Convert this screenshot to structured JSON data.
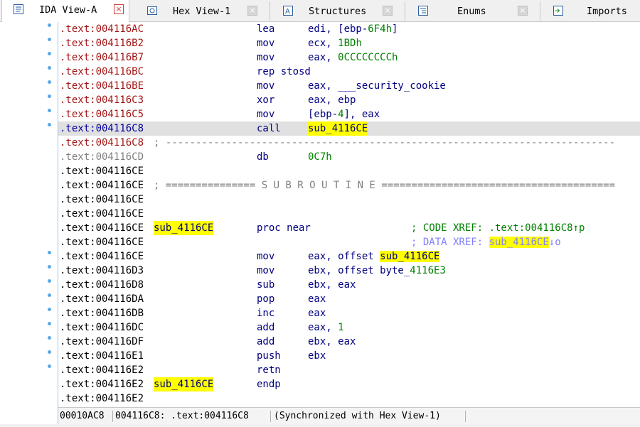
{
  "tabs": [
    {
      "label": "IDA View-A",
      "icon": "disassembly-view-icon",
      "active": true
    },
    {
      "label": "Hex View-1",
      "icon": "hex-view-icon",
      "active": false
    },
    {
      "label": "Structures",
      "icon": "structures-icon",
      "active": false
    },
    {
      "label": "Enums",
      "icon": "enums-icon",
      "active": false
    },
    {
      "label": "Imports",
      "icon": "imports-icon",
      "active": false
    }
  ],
  "close_glyph": "×",
  "listing": {
    "rows": [
      {
        "addr": ".text:004116AC",
        "mnem": "lea",
        "op": "edi, [ebp-6F4h]"
      },
      {
        "addr": ".text:004116B2",
        "mnem": "mov",
        "op": "ecx, 1BDh"
      },
      {
        "addr": ".text:004116B7",
        "mnem": "mov",
        "op": "eax, 0CCCCCCCCh"
      },
      {
        "addr": ".text:004116BC",
        "mnem": "rep stosd",
        "op": ""
      },
      {
        "addr": ".text:004116BE",
        "mnem": "mov",
        "op": "eax, ___security_cookie"
      },
      {
        "addr": ".text:004116C3",
        "mnem": "xor",
        "op": "eax, ebp"
      },
      {
        "addr": ".text:004116C5",
        "mnem": "mov",
        "op": "[ebp-4], eax"
      },
      {
        "addr": ".text:004116C8",
        "mnem": "call",
        "op": "sub_4116CE"
      },
      {
        "addr": ".text:004116C8",
        "comment": "; ---------------------------------------------------------------------------"
      },
      {
        "addr": ".text:004116CD",
        "mnem": "db",
        "op": "0C7h"
      },
      {
        "addr": ".text:004116CE"
      },
      {
        "addr": ".text:004116CE",
        "comment": "; =============== S U B R O U T I N E ======================================="
      },
      {
        "addr": ".text:004116CE"
      },
      {
        "addr": ".text:004116CE"
      },
      {
        "addr": ".text:004116CE",
        "label": "sub_4116CE",
        "mnem": "proc near",
        "xref": "; CODE XREF: .text:004116C8↑p"
      },
      {
        "addr": ".text:004116CE",
        "xref": "; DATA XREF: sub_4116CE↓o"
      },
      {
        "addr": ".text:004116CE",
        "mnem": "mov",
        "op": "eax, offset sub_4116CE"
      },
      {
        "addr": ".text:004116D3",
        "mnem": "mov",
        "op": "ebx, offset byte_4116E3"
      },
      {
        "addr": ".text:004116D8",
        "mnem": "sub",
        "op": "ebx, eax"
      },
      {
        "addr": ".text:004116DA",
        "mnem": "pop",
        "op": "eax"
      },
      {
        "addr": ".text:004116DB",
        "mnem": "inc",
        "op": "eax"
      },
      {
        "addr": ".text:004116DC",
        "mnem": "add",
        "op": "eax, 1"
      },
      {
        "addr": ".text:004116DF",
        "mnem": "add",
        "op": "ebx, eax"
      },
      {
        "addr": ".text:004116E1",
        "mnem": "push",
        "op": "ebx"
      },
      {
        "addr": ".text:004116E2",
        "mnem": "retn",
        "op": ""
      },
      {
        "addr": ".text:004116E2",
        "label": "sub_4116CE",
        "mnem": "endp"
      },
      {
        "addr": ".text:004116E2"
      }
    ]
  },
  "status": {
    "offset": "00010AC8",
    "location": "004116C8: .text:004116C8",
    "sync": "(Synchronized with Hex View-1)"
  },
  "colors": {
    "accent_highlight": "#ffff00",
    "address_red": "#a31515",
    "address_blue": "#0000a0",
    "instruction": "#000080",
    "number_green": "#008000",
    "comment_grey": "#808080",
    "data_xref": "#8080ff",
    "current_line": "#e0e0e0",
    "gutter_dot": "#5aa9e6"
  }
}
